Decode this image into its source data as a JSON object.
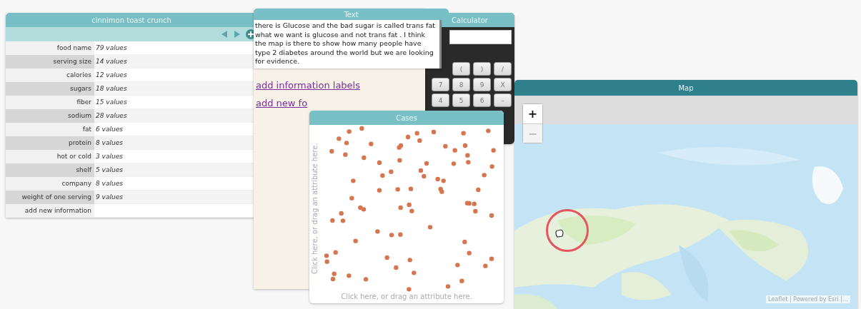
{
  "table": {
    "title": "cinnimon toast crunch",
    "rows": [
      {
        "attribute": "food name",
        "summary": "79 values"
      },
      {
        "attribute": "serving size",
        "summary": "14 values"
      },
      {
        "attribute": "calories",
        "summary": "12 values"
      },
      {
        "attribute": "sugars",
        "summary": "18 values"
      },
      {
        "attribute": "fiber",
        "summary": "15 values"
      },
      {
        "attribute": "sodium",
        "summary": "28 values"
      },
      {
        "attribute": "fat",
        "summary": "6 values"
      },
      {
        "attribute": "protein",
        "summary": "8 values"
      },
      {
        "attribute": "hot or cold",
        "summary": "3 values"
      },
      {
        "attribute": "shelf",
        "summary": "5 values"
      },
      {
        "attribute": "company",
        "summary": "8 values"
      },
      {
        "attribute": "weight of one serving",
        "summary": "9 values"
      },
      {
        "attribute": "add new information"
      }
    ]
  },
  "calculator": {
    "title": "Calculator",
    "key_rows": [
      [
        "(",
        ")",
        "/"
      ],
      [
        "7",
        "8",
        "9",
        "X"
      ],
      [
        "4",
        "5",
        "6",
        "–"
      ]
    ]
  },
  "text_window": {
    "title": "Text",
    "note": "there is Glucose and the bad sugar is called trans fat what we want is glucose and not trans fat . I think the map is there to show how many people have type 2 diabetes around the world but we are looking for evidence.",
    "links": [
      "add information labels",
      "add new fo"
    ]
  },
  "cases": {
    "title": "Cases",
    "y_axis_hint": "Click here, or drag an attribute here.",
    "x_axis_hint": "Click here, or drag an attribute here."
  },
  "map": {
    "title": "Map",
    "zoom_in": "+",
    "zoom_out": "−",
    "attribution": "Leaflet | Powered by Esri |…"
  }
}
